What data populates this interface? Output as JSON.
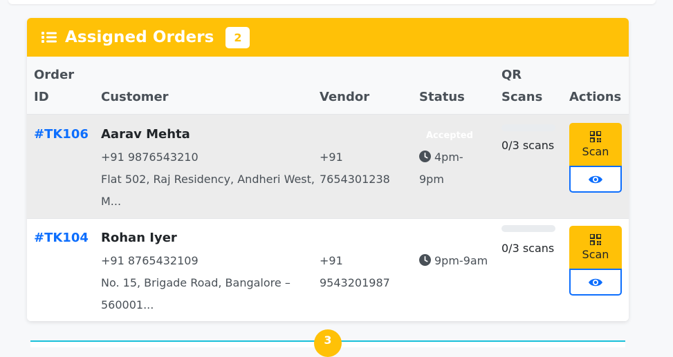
{
  "header": {
    "title": "Assigned Orders",
    "count": "2",
    "icon": "list-icon"
  },
  "columns": {
    "order_id_1": "Order",
    "order_id_2": "ID",
    "customer": "Customer",
    "vendor": "Vendor",
    "status": "Status",
    "qr_scans_1": "QR",
    "qr_scans_2": "Scans",
    "actions": "Actions"
  },
  "orders": [
    {
      "id": "#TK106",
      "customer_name": "Aarav Mehta",
      "customer_phone": "+91 9876543210",
      "address_1": "Flat 502, Raj Residency, Andheri West,",
      "address_2": "M...",
      "vendor_1": "+91",
      "vendor_2": "7654301238",
      "status_badge": "Accepted",
      "time_1": "4pm-",
      "time_2": "9pm",
      "scans_text": "0/3 scans",
      "scan_progress": 0,
      "scan_label": "Scan"
    },
    {
      "id": "#TK104",
      "customer_name": "Rohan Iyer",
      "customer_phone": "+91 8765432109",
      "address_1": "No. 15, Brigade Road, Bangalore –",
      "address_2": "560001...",
      "vendor_1": "+91",
      "vendor_2": "9543201987",
      "status_badge": "",
      "time_1": "9pm-9am",
      "time_2": "",
      "scans_text": "0/3 scans",
      "scan_progress": 0,
      "scan_label": "Scan"
    }
  ],
  "next_section": {
    "count": "3"
  },
  "colors": {
    "accent": "#ffc107",
    "link": "#0d6efd",
    "next_border": "#18c0d9"
  }
}
